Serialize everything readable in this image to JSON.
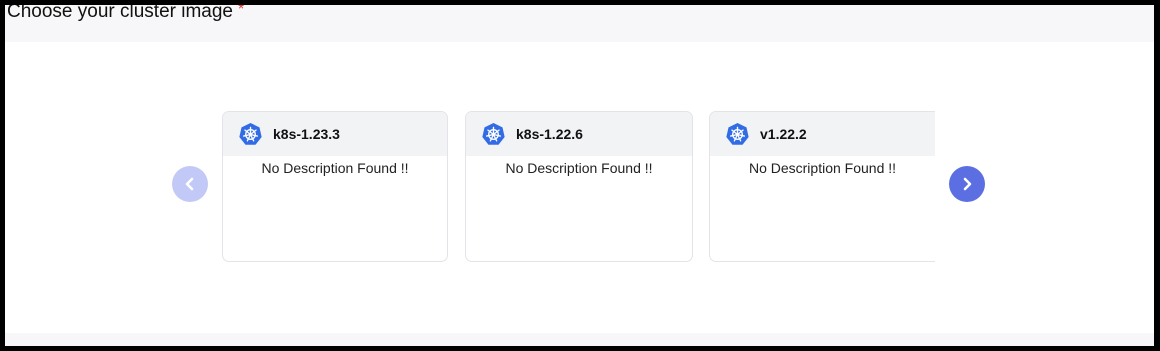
{
  "section": {
    "title": "Choose your cluster image",
    "required_marker": "*"
  },
  "carousel": {
    "prev_icon": "chevron-left-icon",
    "next_icon": "chevron-right-icon",
    "cards": [
      {
        "name": "k8s-1.23.3",
        "description": "No Description Found !!",
        "icon": "kubernetes-icon"
      },
      {
        "name": "k8s-1.22.6",
        "description": "No Description Found !!",
        "icon": "kubernetes-icon"
      },
      {
        "name": "v1.22.2",
        "description": "No Description Found !!",
        "icon": "kubernetes-icon"
      }
    ]
  },
  "colors": {
    "accent": "#5b6fe3",
    "accent_disabled": "#c3c9f7",
    "kubernetes_blue": "#326ce5",
    "required": "#e0312d"
  }
}
